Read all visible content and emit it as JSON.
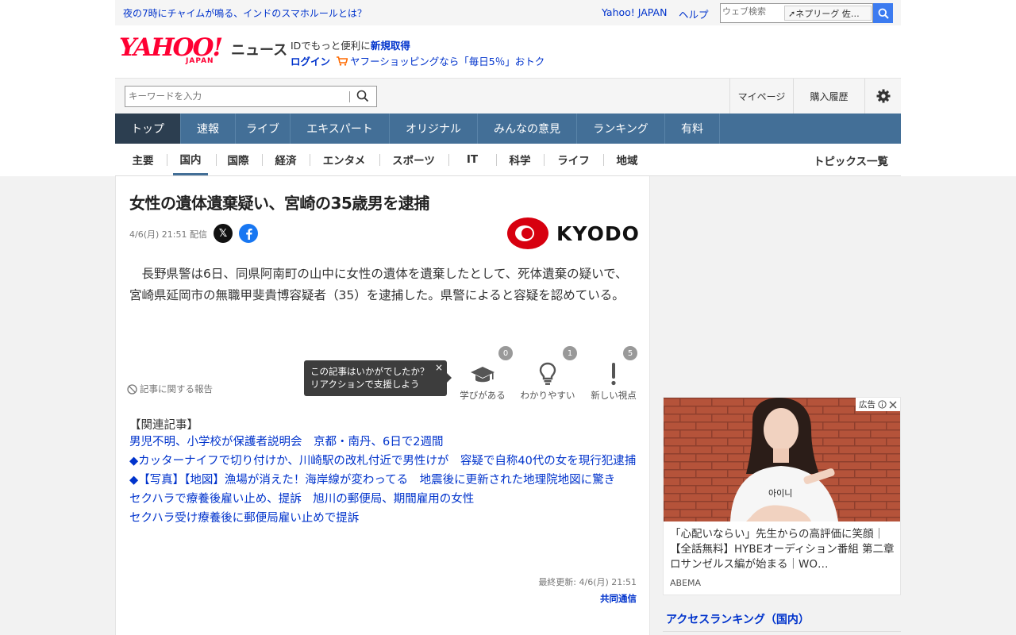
{
  "util": {
    "teaser": "夜の7時にチャイムが鳴る、インドのスマホルールとは？",
    "yahoo_japan": "Yahoo! JAPAN",
    "help": "ヘルプ",
    "web_search_placeholder": "ウェブ検索",
    "trend_chip": "ネプリーグ 佐…"
  },
  "logo": {
    "brand": "YAHOO!",
    "sub": "JAPAN",
    "service": "ニュース"
  },
  "account": {
    "promo_prefix": "IDでもっと便利に",
    "register": "新規取得",
    "login": "ログイン",
    "shopping": "ヤフーショッピングなら「毎日5％」おトク",
    "mypage": "マイページ",
    "history": "購入履歴"
  },
  "search": {
    "placeholder": "キーワードを入力"
  },
  "nav": [
    {
      "label": "トップ"
    },
    {
      "label": "速報"
    },
    {
      "label": "ライブ"
    },
    {
      "label": "エキスパート"
    },
    {
      "label": "オリジナル"
    },
    {
      "label": "みんなの意見"
    },
    {
      "label": "ランキング"
    },
    {
      "label": "有料"
    }
  ],
  "subnav": [
    {
      "label": "主要"
    },
    {
      "label": "国内"
    },
    {
      "label": "国際"
    },
    {
      "label": "経済"
    },
    {
      "label": "エンタメ"
    },
    {
      "label": "スポーツ"
    },
    {
      "label": "IT"
    },
    {
      "label": "科学"
    },
    {
      "label": "ライフ"
    },
    {
      "label": "地域"
    }
  ],
  "subnav_topics": "トピックス一覧",
  "article": {
    "headline": "女性の遺体遺棄疑い、宮崎の35歳男を逮捕",
    "published": "4/6(月) 21:51 配信",
    "publisher_logo": "KYODO",
    "body": "長野県警は6日、同県阿南町の山中に女性の遺体を遺棄したとして、死体遺棄の疑いで、宮崎県延岡市の無職甲斐貴博容疑者（35）を逮捕した。県警によると容疑を認めている。",
    "report": "記事に関する報告",
    "tooltip_line1": "この記事はいかがでしたか？",
    "tooltip_line2": "リアクションで支援しよう",
    "tooltip_close": "×",
    "reactions": [
      {
        "label": "学びがある",
        "count": "0"
      },
      {
        "label": "わかりやすい",
        "count": "1"
      },
      {
        "label": "新しい視点",
        "count": "5"
      }
    ],
    "related_title": "【関連記事】",
    "related": [
      {
        "text": "男児不明、小学校が保護者説明会　京都・南丹、6日で2週間"
      },
      {
        "text": "◆カッターナイフで切り付けか、川崎駅の改札付近で男性けが　容疑で自称40代の女を現行犯逮捕"
      },
      {
        "text": "◆【写真】【地図】漁場が消えた！海岸線が変わってる　地震後に更新された地理院地図に驚き"
      },
      {
        "text": "セクハラで療養後雇い止め、提訴　旭川の郵便局、期間雇用の女性"
      },
      {
        "text": "セクハラ受け療養後に郵便局雇い止めで提訴"
      }
    ],
    "updated": "最終更新: 4/6(月) 21:51",
    "source": "共同通信"
  },
  "ad": {
    "label": "広告",
    "shirt_text": "아이니",
    "title": "「心配いならい」先生からの高評価に笑顔｜【全話無料】HYBEオーディション番組 第二章 ロサンゼルス編が始まる｜WO…",
    "advertiser": "ABEMA"
  },
  "sidebar": {
    "ranking_title": "アクセスランキング（国内）"
  },
  "colors": {
    "link": "#0033cc",
    "nav_bg": "#436f97",
    "nav_active": "#2c3e50",
    "logo_red": "#ff0033",
    "kyodo_red": "#d7000f"
  }
}
